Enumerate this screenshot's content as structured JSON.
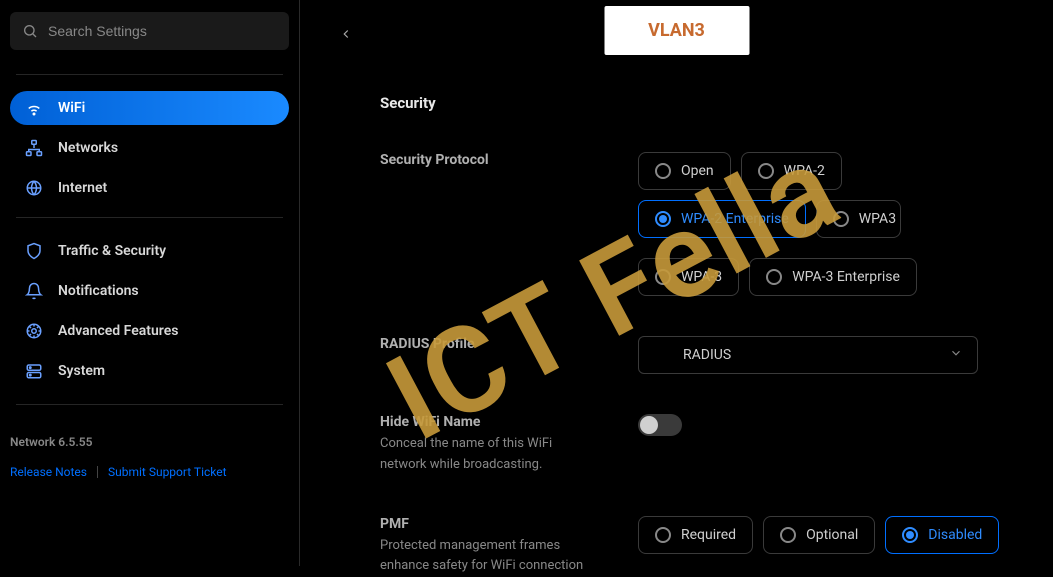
{
  "search": {
    "placeholder": "Search Settings"
  },
  "sidebar": {
    "items": [
      {
        "label": "WiFi"
      },
      {
        "label": "Networks"
      },
      {
        "label": "Internet"
      },
      {
        "label": "Traffic & Security"
      },
      {
        "label": "Notifications"
      },
      {
        "label": "Advanced Features"
      },
      {
        "label": "System"
      }
    ],
    "version": "Network 6.5.55",
    "release_notes": "Release Notes",
    "support_ticket": "Submit Support Ticket"
  },
  "header": {
    "title": "VLAN3"
  },
  "section": {
    "title": "Security"
  },
  "fields": {
    "protocol": {
      "label": "Security Protocol",
      "options": {
        "open": "Open",
        "wpa2": "WPA-2",
        "wpa2_ent": "WPA-2 Enterprise",
        "wpa3only": "WPA3",
        "wpa3": "WPA-3",
        "wpa3_ent": "WPA-3 Enterprise"
      },
      "selected": "wpa2_ent"
    },
    "radius": {
      "label": "RADIUS Profile",
      "value": "RADIUS"
    },
    "hide_name": {
      "label": "Hide WiFi Name",
      "desc": "Conceal the name of this WiFi network while broadcasting.",
      "value": false
    },
    "pmf": {
      "label": "PMF",
      "desc": "Protected management frames enhance safety for WiFi connection",
      "options": {
        "required": "Required",
        "optional": "Optional",
        "disabled": "Disabled"
      },
      "selected": "disabled"
    }
  },
  "watermark": "ICT Fella"
}
